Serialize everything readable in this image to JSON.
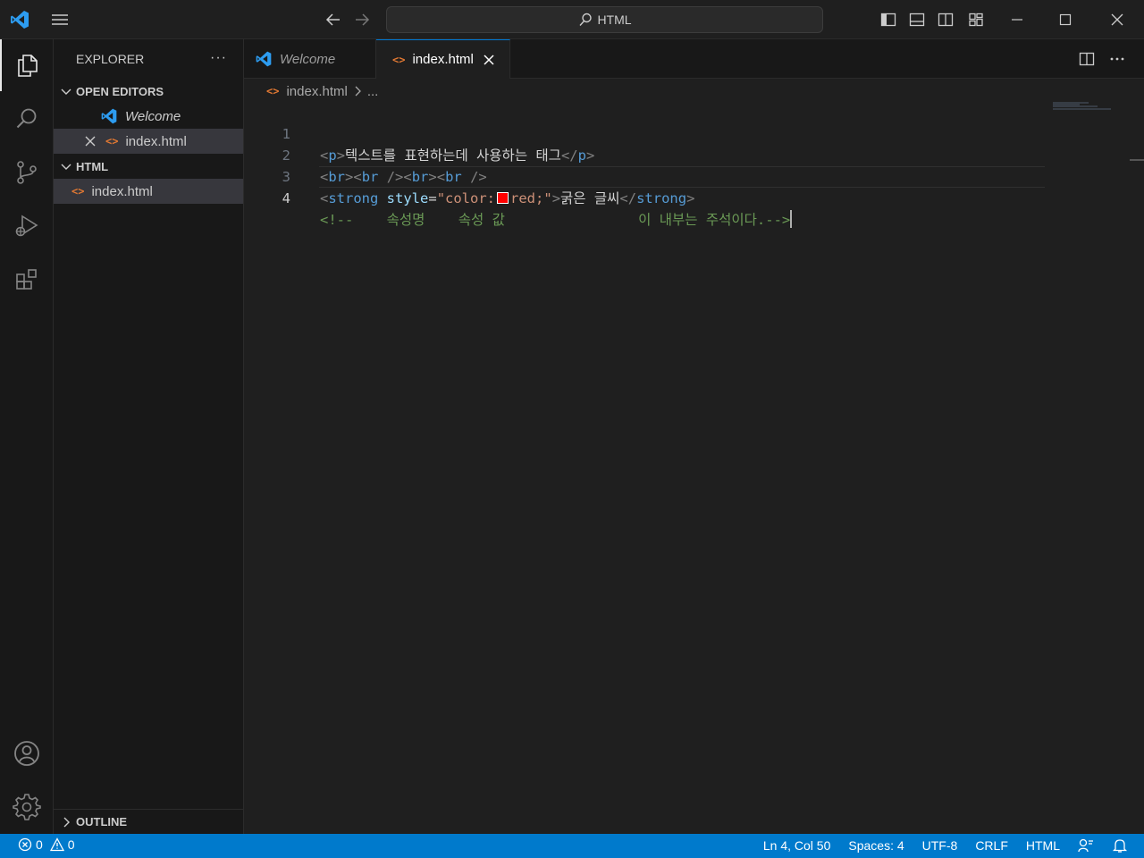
{
  "titlebar": {
    "search_text": "HTML"
  },
  "explorer": {
    "title": "EXPLORER",
    "more": "···",
    "open_editors": {
      "label": "OPEN EDITORS",
      "items": [
        {
          "label": "Welcome"
        },
        {
          "label": "index.html"
        }
      ]
    },
    "folder": {
      "label": "HTML",
      "items": [
        {
          "label": "index.html"
        }
      ]
    },
    "outline_label": "OUTLINE"
  },
  "tabs": [
    {
      "label": "Welcome",
      "icon": "vscode-icon",
      "active": false
    },
    {
      "label": "index.html",
      "icon": "html-file-icon",
      "active": true
    }
  ],
  "breadcrumb": {
    "file": "index.html",
    "rest": "..."
  },
  "editor": {
    "line_numbers": [
      "1",
      "2",
      "3",
      "4"
    ],
    "current_line": 4,
    "line1": {
      "open_lt": "<",
      "open_name": "p",
      "open_gt": ">",
      "text": "텍스트를 표현하는데 사용하는 태그",
      "close_lt": "</",
      "close_name": "p",
      "close_gt": ">"
    },
    "line2": {
      "a_lt": "<",
      "a_name": "br",
      "a_gt": ">",
      "b_lt": "<",
      "b_name": "br",
      "b_gt": " />",
      "c_lt": "<",
      "c_name": "br",
      "c_gt": ">",
      "d_lt": "<",
      "d_name": "br",
      "d_gt": " />"
    },
    "line3": {
      "open_lt": "<",
      "open_name": "strong",
      "attr": " style",
      "eq": "=",
      "str_a": "\"color:",
      "str_b": "red;\"",
      "gt": ">",
      "text": "굵은 글씨",
      "close_lt": "</",
      "close_name": "strong",
      "close_gt": ">"
    },
    "line4": {
      "comment": "<!--    속성명    속성 값                이 내부는 주석이다.-->"
    },
    "swatch_color": "#ff0000"
  },
  "statusbar": {
    "errors": "0",
    "warnings": "0",
    "position": "Ln 4, Col 50",
    "spaces": "Spaces: 4",
    "encoding": "UTF-8",
    "eol": "CRLF",
    "language": "HTML"
  },
  "colors": {
    "accent": "#007acc",
    "tag_name": "#569cd6",
    "attribute": "#9cdcfe",
    "string": "#ce9178",
    "comment": "#6a9955",
    "html_icon": "#e37933"
  }
}
